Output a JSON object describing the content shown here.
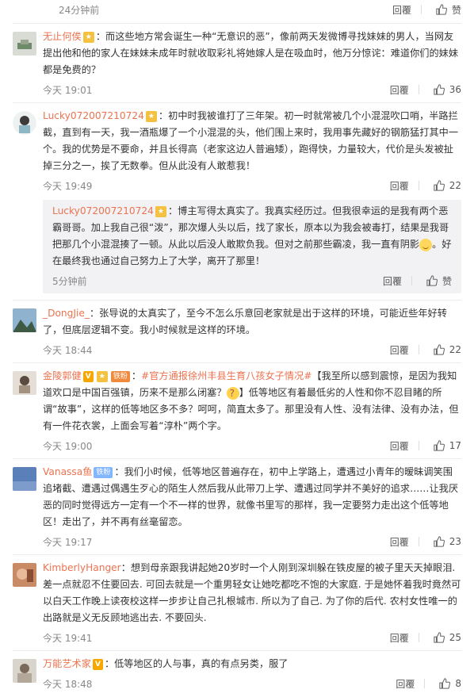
{
  "top": {
    "time": "24分钟前",
    "reply": "回覆",
    "like": "赞"
  },
  "comments": [
    {
      "user": "无止何俟",
      "text": "：而这些地方常会诞生一种“无意识的恶”，像前两天发微博寻找妹妹的男人，当网友提出他和他的家人在妹妹未成年时就收取彩礼将她嫁人是在吸血时，他万分惊诧：难道你们的妹妹都是免费的？",
      "time": "今天 19:01",
      "reply": "回覆",
      "likes": "36"
    },
    {
      "user": "Lucky072007210724",
      "text": "：初中时我被谁打了三年架。初一时就常被几个小混混吹口哨，半路拦截，直到有一天，我一酒瓶爆了一个小混混的头，他们围上来时，我用事先藏好的钢筋猛打其中一个。我的优势是不要命，并且长得高（老家这边人普遍矮），跑得快，力量较大，代价是头发被扯掉三分之一，挨了无数拳。但从此没有人敢惹我！",
      "time": "今天 19:49",
      "reply": "回覆",
      "likes": "22",
      "sub": {
        "user": "Lucky072007210724",
        "text1": "：博主写得太真实了。我真实经历过。但我很幸运的是我有两个恶霸哥哥。加上我自己很“泼”，那次爆人头以后，找了家长，原本以为我会被毒打，结果是我哥把那几个小混混揍了一顿。从此以后没人敢欺负我。但对之前那些霸凌，我一直有阴影",
        "text2": "。好在最终我也通过自己努力上了大学，离开了那里！",
        "time": "5分钟前",
        "reply": "回覆",
        "like": "赞"
      }
    },
    {
      "user": "_DongJie_",
      "text": "：张导说的太真实了，至今不怎么乐意回老家就是出于这样的环境，可能近些年好转了，但底层逻辑不变。我小时候就是这样的环境。",
      "time": "今天 18:44",
      "reply": "回覆",
      "likes": "22"
    },
    {
      "user": "金陵郭健",
      "badge": "铁粉",
      "text_pre": "：",
      "hashtag": "#官方通报徐州丰县生育八孩女子情况#",
      "text": "【我至所以感到震惊，是因为我知道欢口是中国百强镇，历来不是那么闭塞？",
      "text2": "】低等地区有着最低劣的人性和你不忍目睹的所谓“故事”，这样的低等地区多不多？呵呵，简直太多了。那里没有人性、没有法律、没有办法，但有一件花衣裳，上面会写着“淳朴”两个字。",
      "time": "今天 19:00",
      "reply": "回覆",
      "likes": "17"
    },
    {
      "user": "Vanassa鱼",
      "badge": "铁粉",
      "text": "：我们小时候，低等地区普遍存在，初中上学路上，遭遇过小青年的暧昧调笑围追堵截、遭遇过偶遇生歹心的陌生人然后我从此带刀上学、遭遇过同学并不美好的追求……让我厌恶的同时觉得远方一定有一个不一样的世界，就像书里写的那样，我一定要努力走出这个低等地区！走出了，并不再有丝毫留恋。",
      "time": "今天 19:17",
      "reply": "回覆",
      "likes": "23"
    },
    {
      "user": "KimberlyHanger",
      "text": "：想到母亲跟我讲起她20岁时一个人刚到深圳躲在铁皮屋的被子里天天掉眼泪. 差一点就忍不住要回去. 可回去就是一个重男轻女让她吃都吃不饱的大家庭. 于是她怀着我时竟然可以白天工作晚上读夜校这样一步步让自己扎根城市. 所以为了自己. 为了你的后代. 农村女性唯一的出路就是义无反顾地逃出去. 不要回头.",
      "time": "今天 19:41",
      "reply": "回覆",
      "likes": "25"
    },
    {
      "user": "万能艺术家",
      "text": "：低等地区的人与事，真的有点另类，服了",
      "time": "今天 18:48",
      "reply": "回覆",
      "likes": "8"
    }
  ],
  "colors": {
    "username": "#eb7350",
    "meta": "#888888",
    "replybg": "#f2f2f5"
  }
}
